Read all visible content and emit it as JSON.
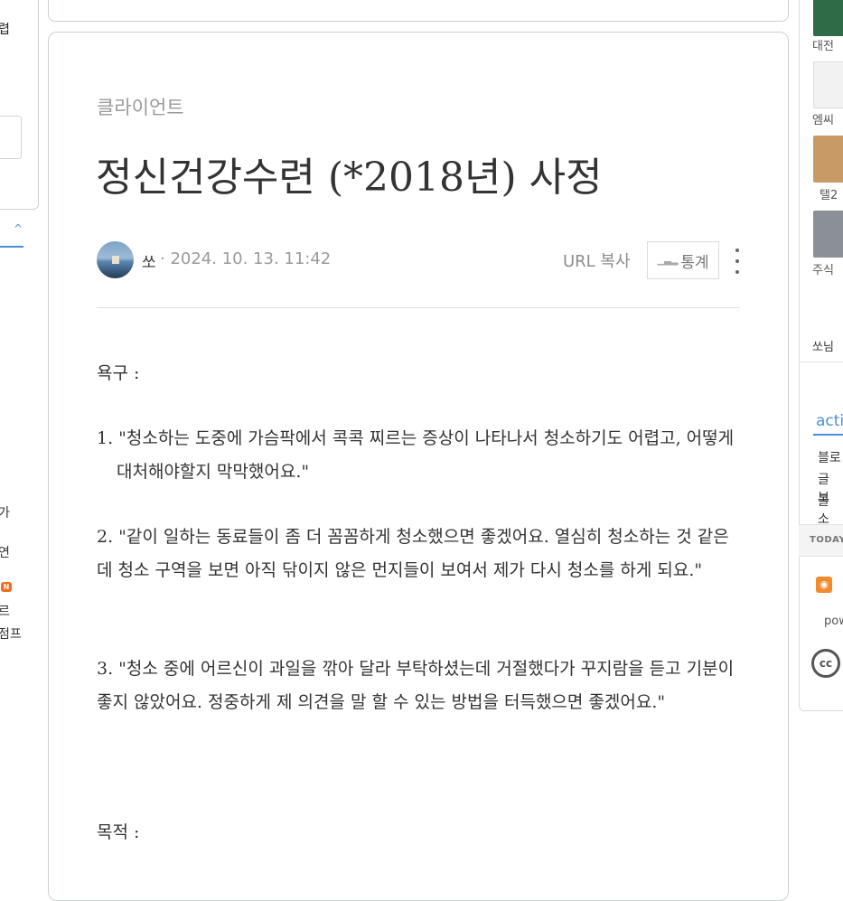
{
  "left_panel": {
    "top_text": "렵",
    "nav_items": [
      "가",
      "연",
      "르",
      "점프"
    ],
    "new_badge": "N"
  },
  "post": {
    "category": "클라이언트",
    "title": "정신건강수련 (*2018년) 사정",
    "author": "쏘",
    "date": "· 2024. 10. 13. 11:42",
    "url_copy": "URL 복사",
    "stats": "통계",
    "stats_icon": "bar-chart-icon",
    "more_icon": "more-vertical-icon",
    "paragraphs": [
      "욕구 :",
      "1. \"청소하는 도중에 가슴팍에서 콕콕 찌르는 증상이 나타나서 청소하기도 어렵고, 어떻게 대처해야할지 막막했어요.\"",
      "2. \"같이 일하는 동료들이 좀 더 꼼꼼하게 청소했으면 좋겠어요. 열심히 청소하는 것 같은데 청소 구역을 보면 아직 닦이지 않은 먼지들이 보여서 제가 다시 청소를 하게 되요.\"",
      "3. \"청소 중에 어르신이 과일을 깎아 달라 부탁하셨는데 거절했다가 꾸지람을 듣고 기분이 좋지 않았어요. 정중하게 제 의견을 말 할 수 있는 방법을 터득했으면 좋겠어요.\"",
      "목적 :"
    ]
  },
  "right_panel": {
    "thumbs": [
      {
        "label": "대전",
        "color": "#2f6b47"
      },
      {
        "label": "엠씨",
        "color": "#f2f2f2"
      },
      {
        "label": "탤2",
        "color": "#c89a66"
      },
      {
        "label": "주식",
        "color": "#8b8f96"
      }
    ],
    "owner": "쏘님",
    "tab": "acti",
    "links": [
      "블로",
      "글 보",
      "글 소"
    ],
    "today": "TODAY",
    "rss_icon": "rss-icon",
    "powered": "pow",
    "cc_icon": "creative-commons-icon",
    "cc_text": "cc"
  }
}
